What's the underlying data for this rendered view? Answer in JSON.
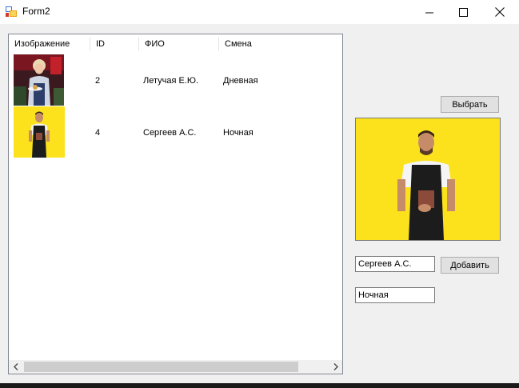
{
  "window": {
    "title": "Form2",
    "minimize_icon": "minimize-icon",
    "maximize_icon": "maximize-icon",
    "close_icon": "close-icon"
  },
  "grid": {
    "columns": [
      "Изображение",
      "ID",
      "ФИО",
      "Смена"
    ],
    "rows": [
      {
        "image": "waitress-photo",
        "id": "2",
        "name": "Летучая Е.Ю.",
        "shift": "Дневная"
      },
      {
        "image": "waiter-photo",
        "id": "4",
        "name": "Сергеев А.С.",
        "shift": "Ночная"
      }
    ]
  },
  "panel": {
    "select_button": "Выбрать",
    "add_button": "Добавить",
    "name_value": "Сергеев А.С.",
    "shift_value": "Ночная",
    "photo": "waiter-photo"
  },
  "colors": {
    "photo_yellow": "#fbe21d",
    "window_bg": "#f0f0f0"
  }
}
